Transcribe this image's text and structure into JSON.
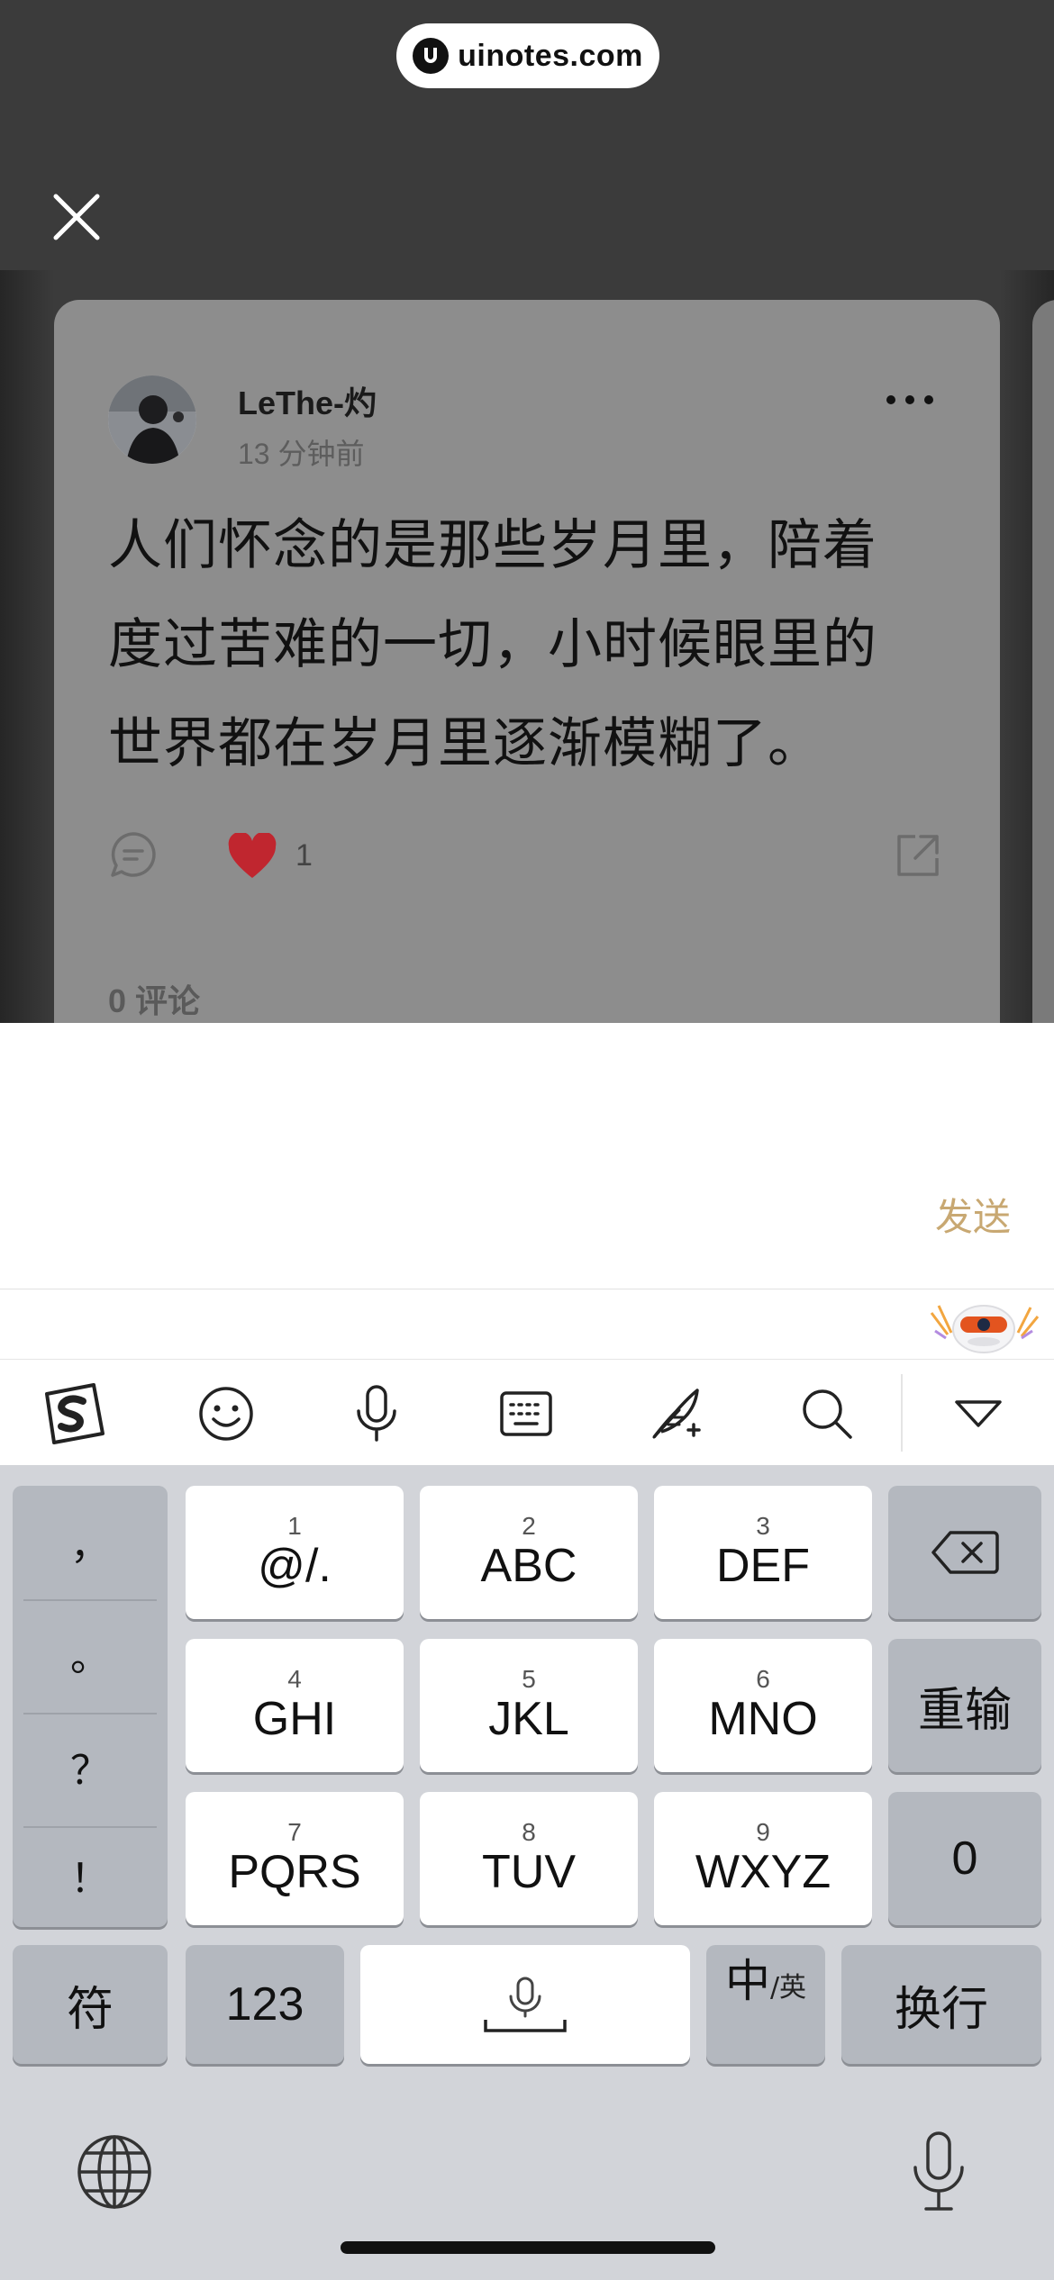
{
  "watermark": {
    "text": "uinotes.com"
  },
  "post": {
    "username": "LeThe-灼",
    "time": "13 分钟前",
    "lines": [
      "人们怀念的是那些岁月里，陪着",
      "度过苦难的一切，小时候眼里的",
      "世界都在岁月里逐渐模糊了。"
    ],
    "like_count": "1",
    "comments_label": "0 评论"
  },
  "input": {
    "send_label": "发送"
  },
  "keyboard": {
    "punctuation": [
      "，",
      "。",
      "？",
      "！"
    ],
    "row1": [
      {
        "num": "1",
        "label": "@/."
      },
      {
        "num": "2",
        "label": "ABC"
      },
      {
        "num": "3",
        "label": "DEF"
      }
    ],
    "row2": [
      {
        "num": "4",
        "label": "GHI"
      },
      {
        "num": "5",
        "label": "JKL"
      },
      {
        "num": "6",
        "label": "MNO"
      }
    ],
    "row3": [
      {
        "num": "7",
        "label": "PQRS"
      },
      {
        "num": "8",
        "label": "TUV"
      },
      {
        "num": "9",
        "label": "WXYZ"
      }
    ],
    "reinput_label": "重输",
    "zero_label": "0",
    "symbols_label": "符",
    "numbers_label": "123",
    "lang_main": "中",
    "lang_sub": "/英",
    "newline_label": "换行"
  },
  "colors": {
    "send": "#c8a872",
    "like": "#c0262f",
    "overlay": "#3b3b3b",
    "card": "#8d8d8d"
  },
  "icons": [
    "close-icon",
    "more-icon",
    "comment-icon",
    "heart-icon",
    "share-icon",
    "sogou-logo-icon",
    "emoji-icon",
    "microphone-icon",
    "keyboard-icon",
    "handwriting-icon",
    "search-icon",
    "collapse-icon",
    "backspace-icon",
    "globe-icon"
  ]
}
